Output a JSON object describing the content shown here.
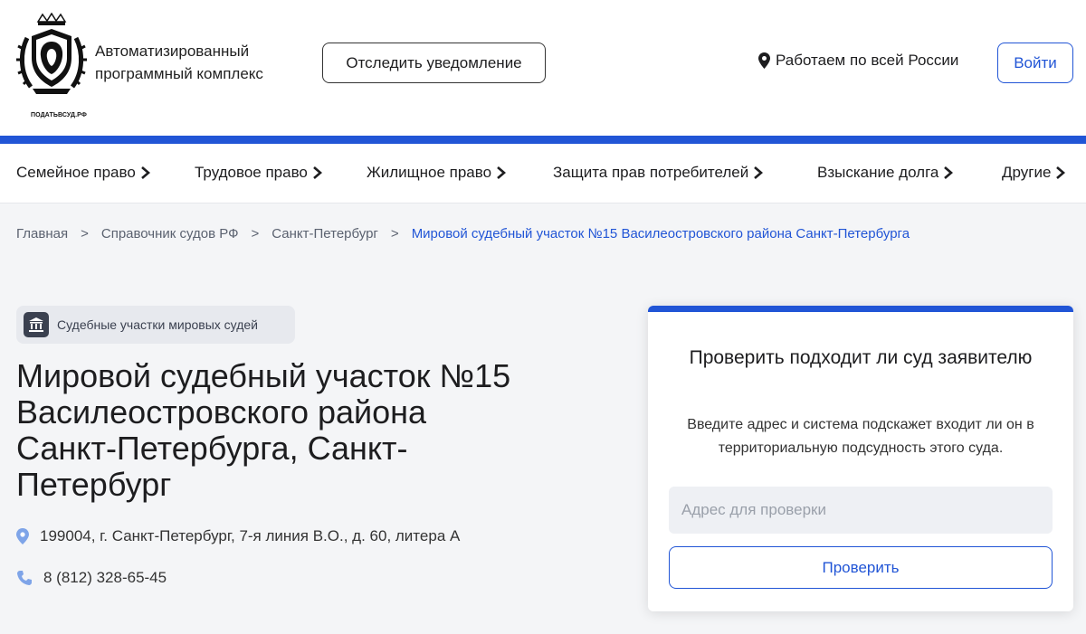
{
  "header": {
    "logo_caption": "ПОДАТЬВСУД.РФ",
    "brand_line1": "Автоматизированный",
    "brand_line2": "программный комплекс",
    "track_button": "Отследить уведомление",
    "region_text": "Работаем по всей России",
    "login_button": "Войти"
  },
  "nav": {
    "items": [
      {
        "label": "Семейное право"
      },
      {
        "label": "Трудовое право"
      },
      {
        "label": "Жилищное право"
      },
      {
        "label": "Защита прав потребителей"
      },
      {
        "label": "Взыскание долга"
      },
      {
        "label": "Другие"
      }
    ]
  },
  "breadcrumbs": {
    "items": [
      {
        "label": "Главная"
      },
      {
        "label": "Справочник судов РФ"
      },
      {
        "label": "Санкт-Петербург"
      },
      {
        "label": "Мировой судебный участок №15 Василеостровского района Санкт-Петербурга"
      }
    ],
    "separator": ">"
  },
  "court": {
    "category": "Судебные участки мировых судей",
    "title": "Мировой судебный участок №15 Василеостровского района Санкт-Петербурга, Санкт-Петербург",
    "address": "199004, г. Санкт-Петербург, 7-я линия В.О., д. 60, литера А",
    "phone": "8 (812) 328-65-45"
  },
  "check_card": {
    "title": "Проверить подходит ли суд заявителю",
    "description": "Введите адрес и система подскажет входит ли он в территориальную подсудность этого суда.",
    "input_placeholder": "Адрес для проверки",
    "input_value": "",
    "button": "Проверить"
  },
  "colors": {
    "accent": "#2155d6",
    "background": "#f4f5f7",
    "icon_soft": "#7ea4e8"
  }
}
